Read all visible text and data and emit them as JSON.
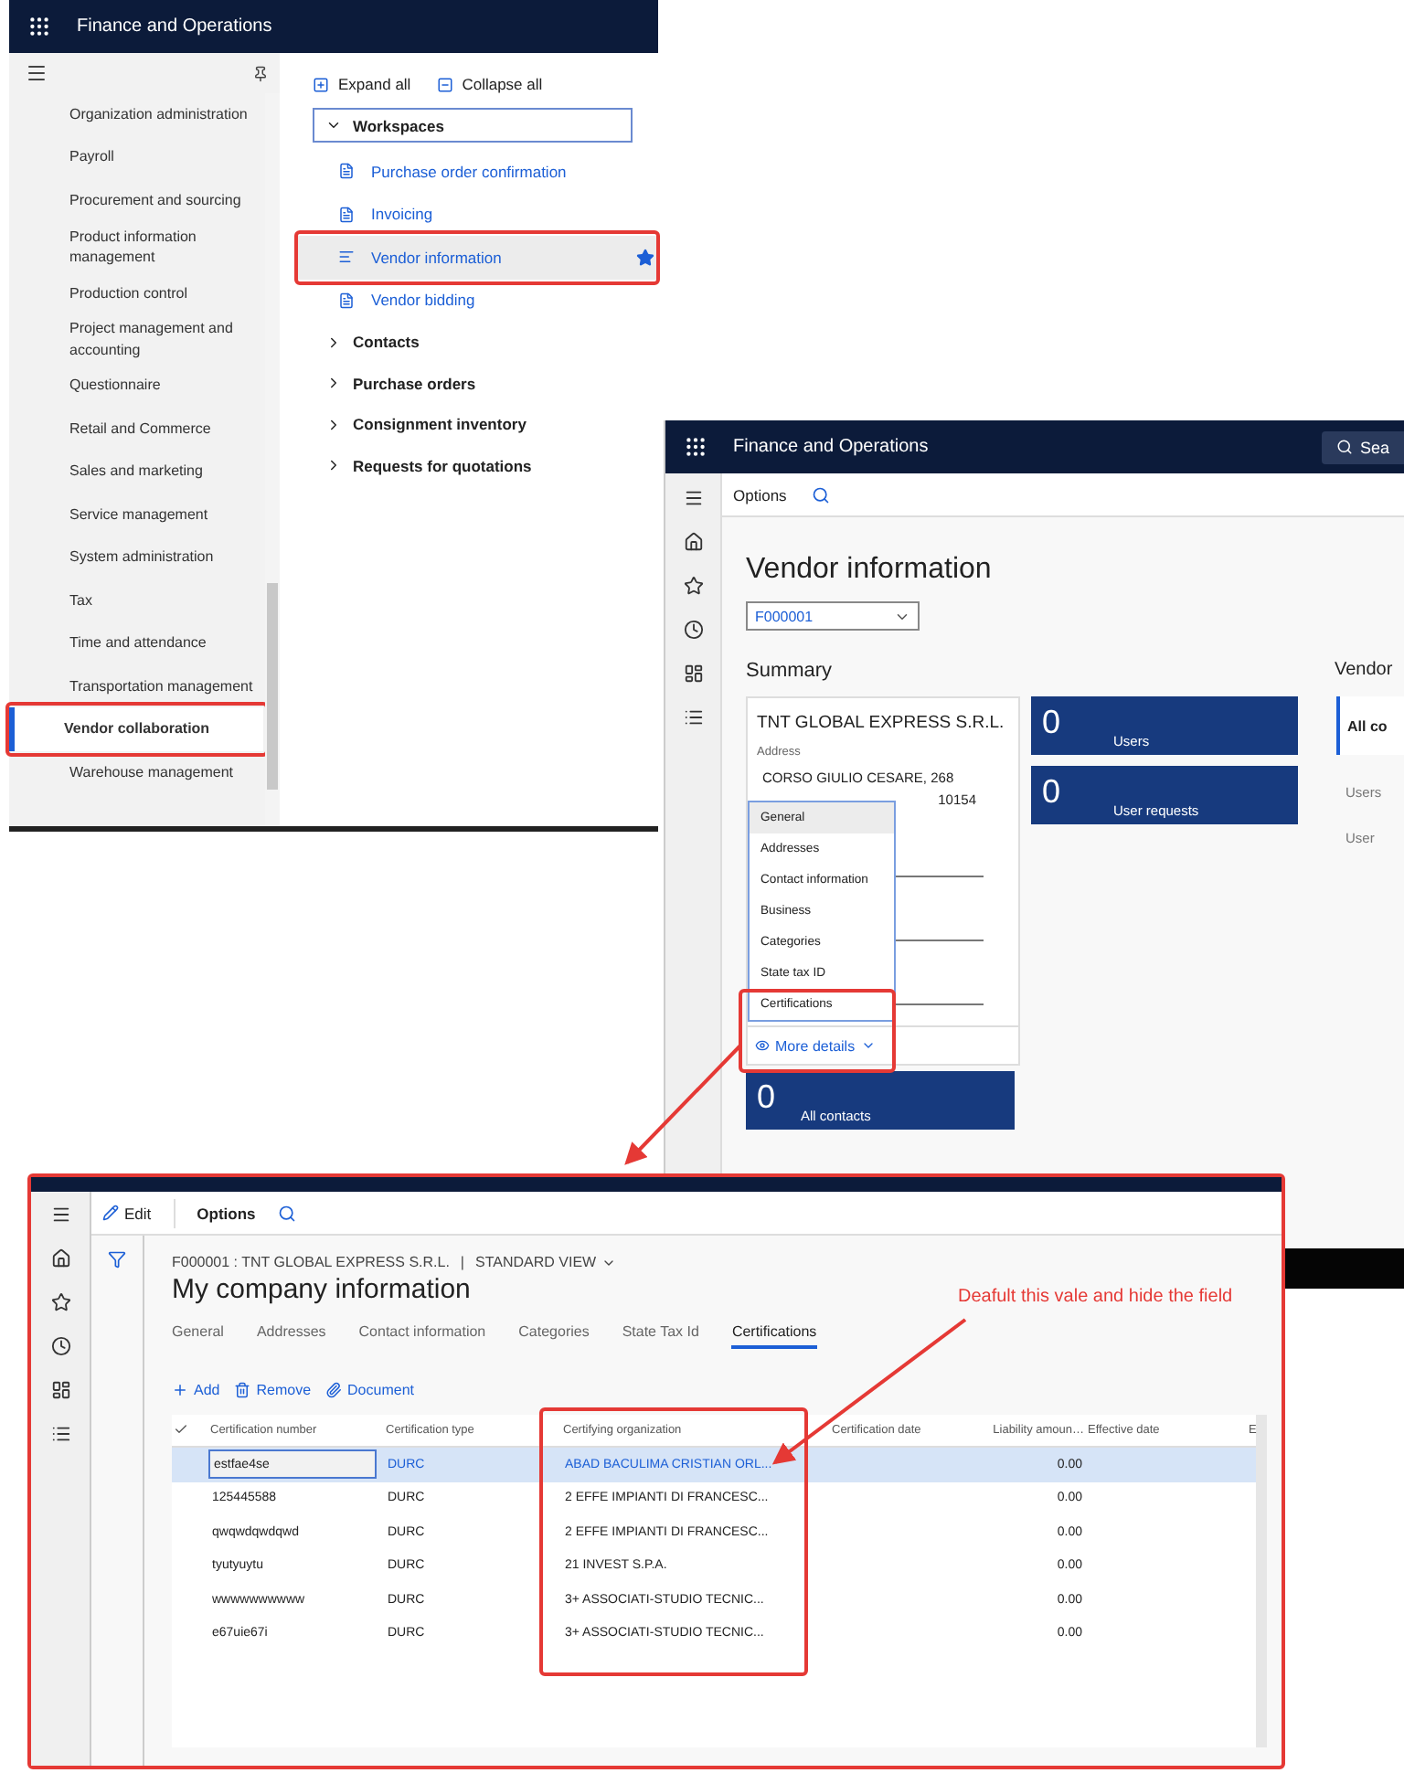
{
  "nav_window": {
    "title": "Finance and Operations",
    "modules": [
      {
        "label": "Organization administration",
        "selected": false
      },
      {
        "label": "Payroll",
        "selected": false
      },
      {
        "label": "Procurement and sourcing",
        "selected": false
      },
      {
        "label": "Product information management",
        "selected": false
      },
      {
        "label": "Production control",
        "selected": false
      },
      {
        "label": "Project management and accounting",
        "selected": false
      },
      {
        "label": "Questionnaire",
        "selected": false
      },
      {
        "label": "Retail and Commerce",
        "selected": false
      },
      {
        "label": "Sales and marketing",
        "selected": false
      },
      {
        "label": "Service management",
        "selected": false
      },
      {
        "label": "System administration",
        "selected": false
      },
      {
        "label": "Tax",
        "selected": false
      },
      {
        "label": "Time and attendance",
        "selected": false
      },
      {
        "label": "Transportation management",
        "selected": false
      },
      {
        "label": "Vendor collaboration",
        "selected": true
      },
      {
        "label": "Warehouse management",
        "selected": false
      }
    ],
    "actions": [
      "Expand all",
      "Collapse all"
    ],
    "groups": [
      {
        "label": "Workspaces",
        "expanded": true,
        "items": [
          {
            "label": "Purchase order confirmation",
            "selected": false,
            "favorite": false
          },
          {
            "label": "Invoicing",
            "selected": false,
            "favorite": false
          },
          {
            "label": "Vendor information",
            "selected": true,
            "favorite": true
          },
          {
            "label": "Vendor bidding",
            "selected": false,
            "favorite": false
          }
        ]
      },
      {
        "label": "Contacts",
        "expanded": false
      },
      {
        "label": "Purchase orders",
        "expanded": false
      },
      {
        "label": "Consignment inventory",
        "expanded": false
      },
      {
        "label": "Requests for quotations",
        "expanded": false
      }
    ]
  },
  "workspace_window": {
    "title": "Finance and Operations",
    "search": "Sea",
    "toolbar": "Options",
    "heading": "Vendor information",
    "vendor": "F000001",
    "summary_title": "Summary",
    "company": "TNT GLOBAL EXPRESS S.R.L.",
    "address_label": "Address",
    "address_lines": [
      "CORSO GIULIO CESARE, 268",
      "10154"
    ],
    "details_menu": [
      {
        "label": "General",
        "selected": true
      },
      {
        "label": "Addresses",
        "selected": false
      },
      {
        "label": "Contact information",
        "selected": false
      },
      {
        "label": "Business",
        "selected": false
      },
      {
        "label": "Categories",
        "selected": false
      },
      {
        "label": "State tax ID",
        "selected": false
      },
      {
        "label": "Certifications",
        "selected": false
      }
    ],
    "more_details": "More details",
    "tiles": [
      {
        "count": "0",
        "label": "Users"
      },
      {
        "count": "0",
        "label": "User requests"
      }
    ],
    "contacts_tile": {
      "count": "0",
      "label": "All contacts"
    },
    "side_title": "Vendor",
    "side_items": [
      "All co",
      "Users",
      "User"
    ]
  },
  "company_window": {
    "edit": "Edit",
    "options": "Options",
    "breadcrumb": "F000001 : TNT GLOBAL EXPRESS S.R.L.",
    "separator": "|",
    "view": "STANDARD VIEW",
    "heading": "My company information",
    "tabs": [
      {
        "label": "General",
        "selected": false
      },
      {
        "label": "Addresses",
        "selected": false
      },
      {
        "label": "Contact information",
        "selected": false
      },
      {
        "label": "Categories",
        "selected": false
      },
      {
        "label": "State Tax Id",
        "selected": false
      },
      {
        "label": "Certifications",
        "selected": true
      }
    ],
    "actions": [
      "Add",
      "Remove",
      "Document"
    ],
    "table": {
      "columns": [
        "Certification number",
        "Certification type",
        "Certifying organization",
        "Certification date",
        "Liability amoun…",
        "Effective date",
        "E"
      ],
      "rows": [
        {
          "number": "estfae4se",
          "type": "DURC",
          "organization": "ABAD BACULIMA CRISTIAN ORL...",
          "liability": "0.00",
          "selected": true
        },
        {
          "number": "125445588",
          "type": "DURC",
          "organization": "2 EFFE IMPIANTI DI FRANCESC...",
          "liability": "0.00",
          "selected": false
        },
        {
          "number": "qwqwdqwdqwd",
          "type": "DURC",
          "organization": "2 EFFE IMPIANTI DI FRANCESC...",
          "liability": "0.00",
          "selected": false
        },
        {
          "number": "tyutyuytu",
          "type": "DURC",
          "organization": "21 INVEST S.P.A.",
          "liability": "0.00",
          "selected": false
        },
        {
          "number": "wwwwwwwwww",
          "type": "DURC",
          "organization": "3+ ASSOCIATI-STUDIO TECNIC...",
          "liability": "0.00",
          "selected": false
        },
        {
          "number": "e67uie67i",
          "type": "DURC",
          "organization": "3+ ASSOCIATI-STUDIO TECNIC...",
          "liability": "0.00",
          "selected": false
        }
      ]
    }
  },
  "annotation": "Deafult this vale and hide the field"
}
